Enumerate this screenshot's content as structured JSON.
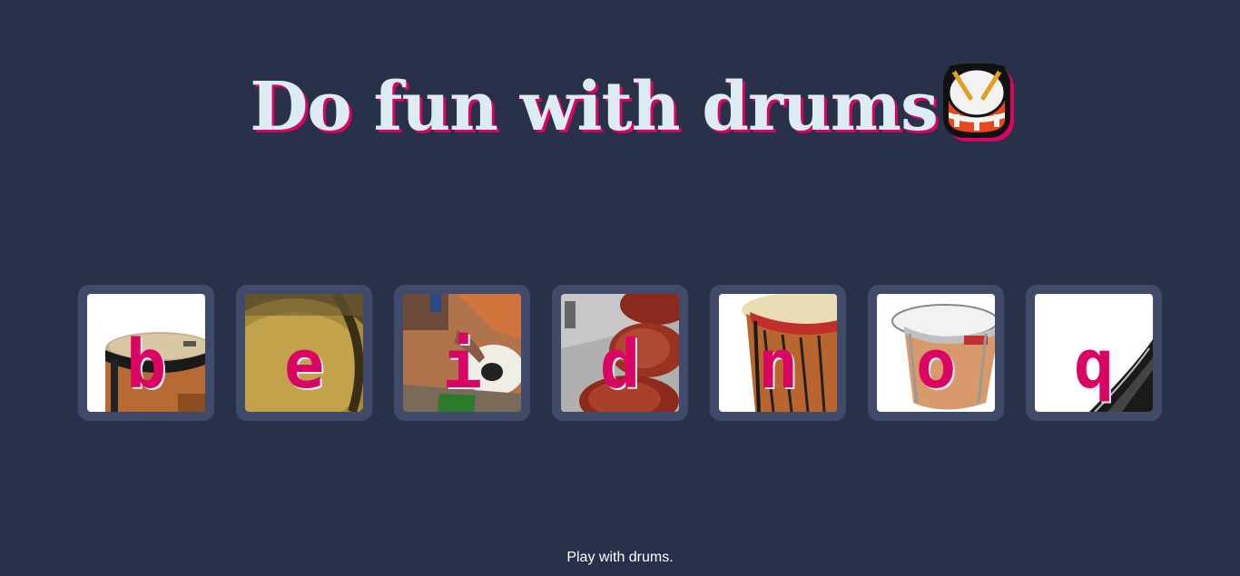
{
  "header": {
    "title": "Do fun with drums",
    "emoji_icon": "drum-icon"
  },
  "pads": [
    {
      "key": "b",
      "image": "bongo-drum"
    },
    {
      "key": "e",
      "image": "drum-head-closeup"
    },
    {
      "key": "i",
      "image": "tabla-hand"
    },
    {
      "key": "d",
      "image": "taiko-drums"
    },
    {
      "key": "n",
      "image": "djembe-drum"
    },
    {
      "key": "o",
      "image": "timpani-drum"
    },
    {
      "key": "q",
      "image": "snare-drum"
    }
  ],
  "footer": {
    "text": "Play with drums."
  },
  "colors": {
    "background": "#283149",
    "pad": "#404b69",
    "accent": "#da0463",
    "title": "#dbedf3"
  }
}
